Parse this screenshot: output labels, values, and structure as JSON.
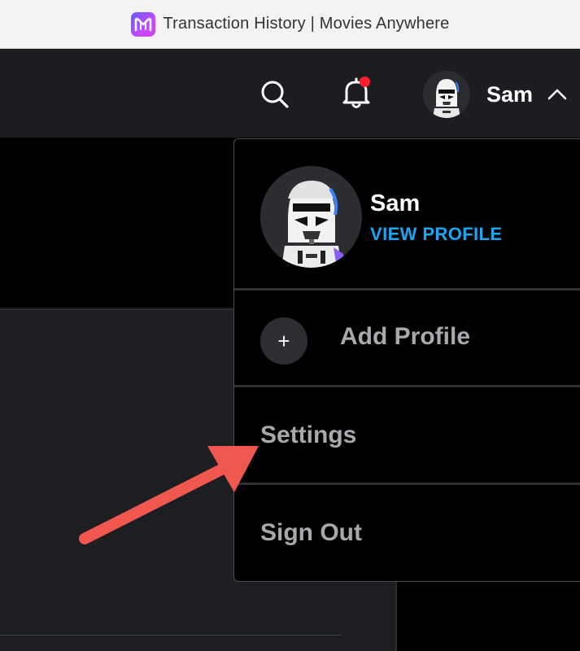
{
  "window": {
    "title": "Transaction History | Movies Anywhere",
    "app_icon": "movies-anywhere-logo"
  },
  "header": {
    "search_icon": "search-icon",
    "notifications_icon": "bell-icon",
    "has_unread_notifications": true,
    "user_name": "Sam",
    "menu_state_icon": "chevron-up-icon"
  },
  "profile_menu": {
    "current_profile": {
      "name": "Sam",
      "view_profile_label": "VIEW PROFILE"
    },
    "add_profile": {
      "icon": "plus-icon",
      "label": "Add Profile"
    },
    "settings_label": "Settings",
    "sign_out_label": "Sign Out"
  },
  "colors": {
    "accent_link": "#1aa6f2",
    "notification_dot": "#ff1d2e",
    "annotation_arrow": "#f0574e"
  }
}
